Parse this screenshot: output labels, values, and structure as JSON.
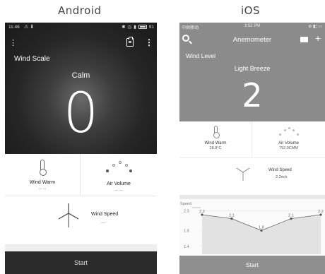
{
  "labels": {
    "android": "Android",
    "ios": "iOS"
  },
  "android": {
    "status_bar": {
      "time": "11:46",
      "battery": "91"
    },
    "scale_title": "Wind Scale",
    "status_word": "Calm",
    "big_value": "0",
    "cards": {
      "wind_warm": {
        "label": "Wind Warm",
        "value": "-- --"
      },
      "air_volume": {
        "label": "Air Volume",
        "value": "-- --"
      },
      "wind_speed": {
        "label": "Wind Speed",
        "value": "---"
      }
    },
    "start_label": "Start",
    "icons": [
      "menu-icon",
      "clipboard-icon",
      "more-vert-icon",
      "thermometer-icon",
      "air-volume-icon",
      "wind-turbine-icon"
    ]
  },
  "ios": {
    "status_bar": {
      "carrier": "中国移动",
      "time": "3:52 PM"
    },
    "nav_title": "Anemometer",
    "level_title": "Wind Level",
    "status_word": "Light Breeze",
    "big_value": "2",
    "cards": {
      "wind_warm": {
        "label": "Wind Warm",
        "value": "28.8°C"
      },
      "air_volume": {
        "label": "Air Volume",
        "value": "792.0CMM"
      },
      "wind_speed": {
        "label": "Wind Speed",
        "value": "2.2m/s"
      }
    },
    "start_label": "Start",
    "icons": [
      "search-icon",
      "folder-icon",
      "plus-icon",
      "thermometer-icon",
      "air-volume-icon",
      "wind-turbine-icon"
    ]
  },
  "chart_data": {
    "type": "area",
    "ylabel": "Speed",
    "y_ticks": [
      "2.3",
      "1.8",
      "1.4"
    ],
    "ylim": [
      1.2,
      2.45
    ],
    "values": [
      2.2,
      2.1,
      1.8,
      2.1,
      2.2
    ],
    "data_labels": [
      "2.2",
      "2.1",
      "1.8",
      "2.1",
      "2.2"
    ],
    "grid": true,
    "colors": {
      "line": "#666666",
      "fill": "#e2e2e2",
      "point": "#555555"
    }
  }
}
